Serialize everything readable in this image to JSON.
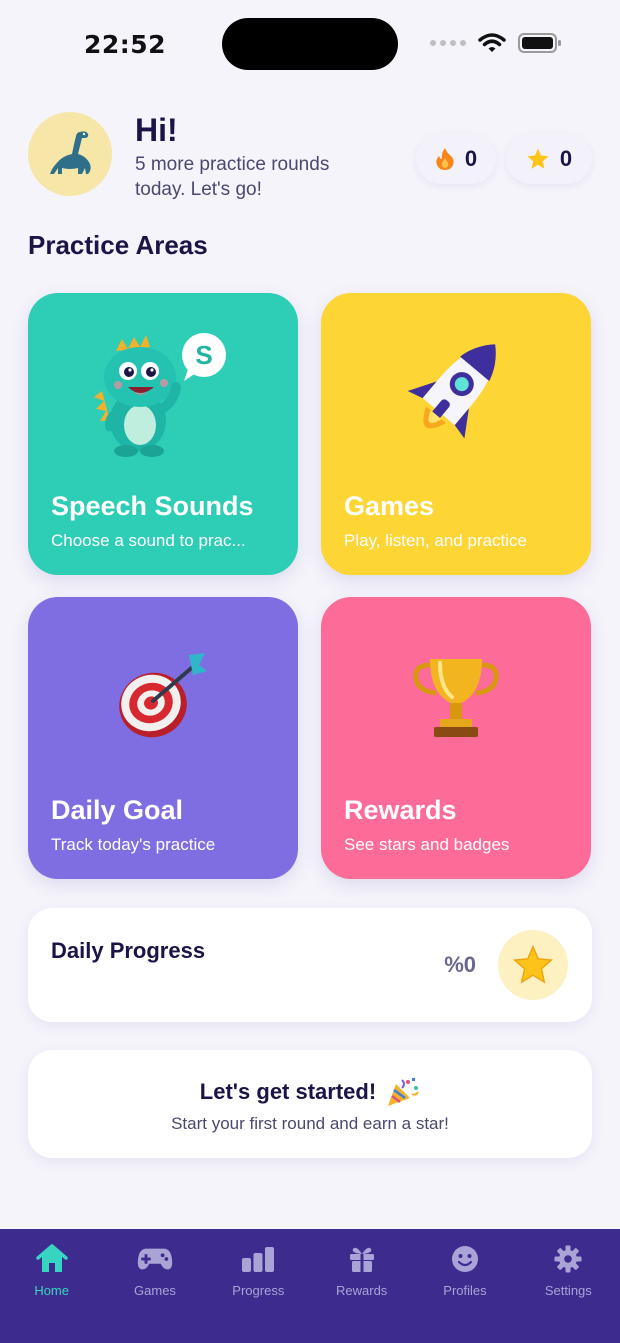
{
  "status_bar": {
    "time": "22:52"
  },
  "header": {
    "title": "Hi!",
    "subtitle": "5 more practice rounds today. Let's go!",
    "streak_count": "0",
    "stars_count": "0"
  },
  "section_title": "Practice Areas",
  "cards": [
    {
      "title": "Speech Sounds",
      "subtitle": "Choose a sound to prac...",
      "color": "#2ecdb5",
      "icon": "dino-mascot-icon",
      "badge": "S"
    },
    {
      "title": "Games",
      "subtitle": "Play, listen, and practice",
      "color": "#fdd535",
      "icon": "rocket-icon"
    },
    {
      "title": "Daily Goal",
      "subtitle": "Track today's practice",
      "color": "#7f6de2",
      "icon": "target-icon"
    },
    {
      "title": "Rewards",
      "subtitle": "See stars and badges",
      "color": "#fd6b98",
      "icon": "trophy-icon"
    }
  ],
  "daily_progress": {
    "title": "Daily Progress",
    "percent_label": "%0",
    "progress_fraction": 0
  },
  "start_card": {
    "title": "Let's get started!",
    "subtitle": "Start your first round and earn a star!"
  },
  "tabs": [
    {
      "label": "Home",
      "icon": "home-icon",
      "active": true
    },
    {
      "label": "Games",
      "icon": "gamepad-icon",
      "active": false
    },
    {
      "label": "Progress",
      "icon": "bar-chart-icon",
      "active": false
    },
    {
      "label": "Rewards",
      "icon": "gift-icon",
      "active": false
    },
    {
      "label": "Profiles",
      "icon": "smiley-icon",
      "active": false
    },
    {
      "label": "Settings",
      "icon": "gear-icon",
      "active": false
    }
  ],
  "colors": {
    "accent": "#38d4c2",
    "tab_bar": "#3d2b8e",
    "text_dark": "#1b1446"
  }
}
